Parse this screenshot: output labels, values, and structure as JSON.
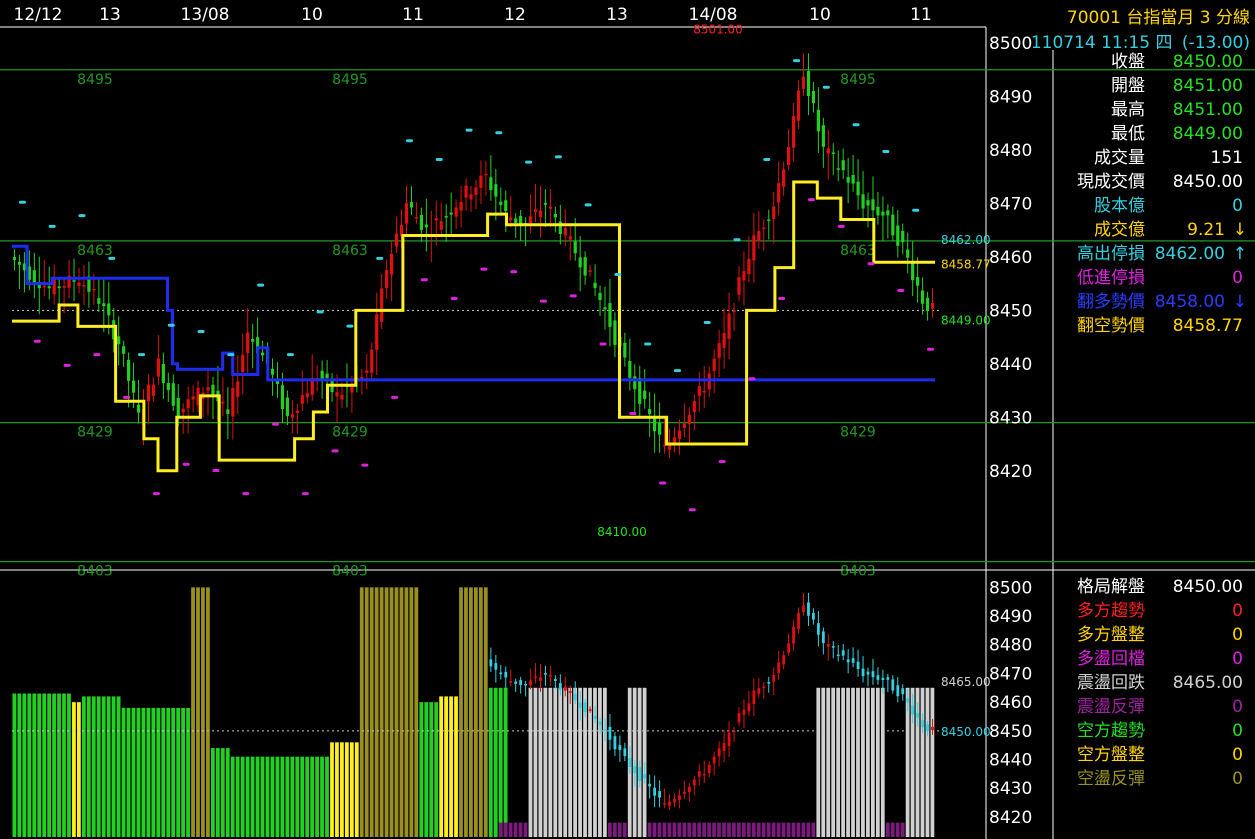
{
  "header": {
    "symbol": "70001",
    "name": "台指當月 3 分線",
    "datetime": "110714 11:15 四",
    "change": "(-13.00)"
  },
  "time_axis": [
    {
      "label": "12/12",
      "x": 38
    },
    {
      "label": "13",
      "x": 110
    },
    {
      "label": "13/08",
      "x": 205
    },
    {
      "label": "10",
      "x": 312
    },
    {
      "label": "11",
      "x": 413
    },
    {
      "label": "12",
      "x": 515
    },
    {
      "label": "13",
      "x": 617
    },
    {
      "label": "14/08",
      "x": 713
    },
    {
      "label": "10",
      "x": 820
    },
    {
      "label": "11",
      "x": 921
    }
  ],
  "quote": {
    "rows": [
      {
        "label": "收盤",
        "value": "8450.00",
        "label_color": "#ffffff",
        "value_color": "#22e022"
      },
      {
        "label": "開盤",
        "value": "8451.00",
        "label_color": "#ffffff",
        "value_color": "#22e022"
      },
      {
        "label": "最高",
        "value": "8451.00",
        "label_color": "#ffffff",
        "value_color": "#22e022"
      },
      {
        "label": "最低",
        "value": "8449.00",
        "label_color": "#ffffff",
        "value_color": "#22e022"
      },
      {
        "label": "成交量",
        "value": "151",
        "label_color": "#ffffff",
        "value_color": "#ffffff"
      },
      {
        "label": "現成交價",
        "value": "8450.00",
        "label_color": "#ffffff",
        "value_color": "#ffffff"
      },
      {
        "label": "股本億",
        "value": "0",
        "label_color": "#34d0e0",
        "value_color": "#34d0e0"
      },
      {
        "label": "成交億",
        "value": "9.21",
        "label_color": "#ffd400",
        "value_color": "#ffd400",
        "arrow": "↓",
        "arrow_color": "#ffd400"
      },
      {
        "label": "高出停損",
        "value": "8462.00",
        "label_color": "#34d0e0",
        "value_color": "#34d0e0",
        "arrow": "↑",
        "arrow_color": "#34d0e0"
      },
      {
        "label": "低進停損",
        "value": "0",
        "label_color": "#e020e0",
        "value_color": "#e020e0"
      },
      {
        "label": "翻多勢價",
        "value": "8458.00",
        "label_color": "#2a3cff",
        "value_color": "#2a3cff",
        "arrow": "↓",
        "arrow_color": "#2a3cff"
      },
      {
        "label": "翻空勢價",
        "value": "8458.77",
        "label_color": "#ffd400",
        "value_color": "#ffd400"
      }
    ]
  },
  "pattern": {
    "rows": [
      {
        "label": "格局解盤",
        "value": "8450.00",
        "label_color": "#ffffff",
        "value_color": "#ffffff"
      },
      {
        "label": "多方趨勢",
        "value": "0",
        "label_color": "#ff2020",
        "value_color": "#ff2020"
      },
      {
        "label": "多方盤整",
        "value": "0",
        "label_color": "#ffd400",
        "value_color": "#ffd400"
      },
      {
        "label": "多盪回檔",
        "value": "0",
        "label_color": "#e020e0",
        "value_color": "#e020e0"
      },
      {
        "label": "震盪回跌",
        "value": "8465.00",
        "label_color": "#d0d0d0",
        "value_color": "#d0d0d0"
      },
      {
        "label": "震盪反彈",
        "value": "0",
        "label_color": "#a020a0",
        "value_color": "#a020a0"
      },
      {
        "label": "空方趨勢",
        "value": "0",
        "label_color": "#22e022",
        "value_color": "#22e022"
      },
      {
        "label": "空方盤整",
        "value": "0",
        "label_color": "#ffd400",
        "value_color": "#ffd400"
      },
      {
        "label": "空盪反彈",
        "value": "0",
        "label_color": "#9a9020",
        "value_color": "#9a9020"
      }
    ]
  },
  "chart_data": {
    "type": "candlestick",
    "upper": {
      "yticks": [
        8500,
        8490,
        8480,
        8470,
        8460,
        8450,
        8440,
        8430,
        8420
      ],
      "ylim": [
        8402,
        8503
      ],
      "levels": [
        {
          "value": 8495,
          "label": "8495"
        },
        {
          "value": 8463,
          "label": "8463"
        },
        {
          "value": 8429,
          "label": "8429"
        },
        {
          "value": 8403,
          "label": "8403"
        }
      ],
      "annotations": [
        {
          "text": "8501.00",
          "value": 8501,
          "color": "#ff2020"
        },
        {
          "text": "8410.00",
          "value": 8410,
          "color": "#22e022"
        }
      ],
      "right_labels": [
        {
          "text": "8462.00",
          "value": 8462,
          "color": "#34d0e0"
        },
        {
          "text": "8458.77",
          "value": 8458.77,
          "color": "#ffd400"
        },
        {
          "text": "8449.00",
          "value": 8449,
          "color": "#22e022"
        }
      ],
      "current_price": 8450,
      "blue_line": [
        8462,
        8462,
        8462,
        8455,
        8455,
        8455,
        8455,
        8455,
        8456,
        8456,
        8456,
        8456,
        8456,
        8456,
        8456,
        8456,
        8456,
        8456,
        8456,
        8456,
        8456,
        8456,
        8456,
        8456,
        8456,
        8456,
        8456,
        8456,
        8456,
        8456,
        8456,
        8450,
        8440,
        8439,
        8439,
        8439,
        8439,
        8439,
        8439,
        8439,
        8439,
        8439,
        8442,
        8442,
        8438,
        8438,
        8438,
        8438,
        8438,
        8443,
        8443,
        8437,
        8437,
        8437,
        8437,
        8437,
        8437,
        8437,
        8437,
        8437,
        8437,
        8437,
        8437,
        8437,
        8437,
        8437,
        8437,
        8437,
        8437,
        8437,
        8437,
        8437,
        8437,
        8437,
        8437,
        8437,
        8437,
        8437,
        8437,
        8437,
        8437,
        8437,
        8437,
        8437,
        8437,
        8437,
        8437,
        8437,
        8437,
        8437,
        8437,
        8437,
        8437,
        8437,
        8437,
        8437,
        8437,
        8437,
        8437,
        8437,
        8437,
        8437,
        8437,
        8437,
        8437,
        8437,
        8437,
        8437,
        8437,
        8437,
        8437,
        8437,
        8437,
        8437,
        8437,
        8437,
        8437,
        8437,
        8437,
        8437,
        8437,
        8437,
        8437,
        8437,
        8437,
        8437,
        8437,
        8437,
        8437,
        8437,
        8437,
        8437,
        8437,
        8437,
        8437,
        8437,
        8437,
        8437,
        8437,
        8437,
        8437,
        8437,
        8437,
        8437,
        8437,
        8437,
        8437,
        8437,
        8437,
        8437,
        8437,
        8437,
        8437,
        8437,
        8437,
        8437,
        8437,
        8437,
        8437,
        8437,
        8437,
        8437,
        8437,
        8437,
        8437,
        8437,
        8437,
        8437,
        8437,
        8437,
        8437,
        8437,
        8437,
        8437,
        8437,
        8437,
        8437,
        8437,
        8437,
        8437,
        8437,
        8437,
        8437,
        8437
      ],
      "yellow_line": [
        8448,
        8448,
        8448,
        8448,
        8448,
        8448,
        8448,
        8448,
        8448,
        8448,
        8451,
        8451,
        8451,
        8451,
        8447,
        8447,
        8447,
        8447,
        8447,
        8447,
        8447,
        8447,
        8433,
        8433,
        8433,
        8433,
        8433,
        8433,
        8426,
        8426,
        8426,
        8420,
        8420,
        8420,
        8420,
        8430,
        8430,
        8430,
        8430,
        8430,
        8434,
        8434,
        8434,
        8434,
        8422,
        8422,
        8422,
        8422,
        8422,
        8422,
        8422,
        8422,
        8422,
        8422,
        8422,
        8422,
        8422,
        8422,
        8422,
        8422,
        8426,
        8426,
        8426,
        8426,
        8431,
        8431,
        8431,
        8436,
        8436,
        8436,
        8436,
        8436,
        8436,
        8450,
        8450,
        8450,
        8450,
        8450,
        8450,
        8450,
        8450,
        8450,
        8450,
        8464,
        8464,
        8464,
        8464,
        8464,
        8464,
        8464,
        8464,
        8464,
        8464,
        8464,
        8464,
        8464,
        8464,
        8464,
        8464,
        8464,
        8464,
        8468,
        8468,
        8468,
        8468,
        8466,
        8466,
        8466,
        8466,
        8466,
        8466,
        8466,
        8466,
        8466,
        8466,
        8466,
        8466,
        8466,
        8466,
        8466,
        8466,
        8466,
        8466,
        8466,
        8466,
        8466,
        8466,
        8466,
        8466,
        8430,
        8430,
        8430,
        8430,
        8430,
        8430,
        8430,
        8430,
        8430,
        8430,
        8425,
        8425,
        8425,
        8425,
        8425,
        8425,
        8425,
        8425,
        8425,
        8425,
        8425,
        8425,
        8425,
        8425,
        8425,
        8425,
        8425,
        8450,
        8450,
        8450,
        8450,
        8450,
        8450,
        8458,
        8458,
        8458,
        8458,
        8474,
        8474,
        8474,
        8474,
        8474,
        8471,
        8471,
        8471,
        8471,
        8471,
        8467,
        8467,
        8467,
        8467,
        8467,
        8467,
        8467,
        8459,
        8459,
        8459,
        8459,
        8459,
        8459,
        8459,
        8459,
        8459,
        8459,
        8459,
        8459,
        8459
      ]
    },
    "lower": {
      "yticks": [
        8500,
        8490,
        8480,
        8470,
        8460,
        8450,
        8440,
        8430,
        8420
      ],
      "ylim": [
        8413,
        8505
      ],
      "right_labels": [
        {
          "text": "8465.00",
          "value": 8465,
          "color": "#d0d0d0"
        },
        {
          "text": "8450.00",
          "value": 8450,
          "color": "#34d0e0"
        }
      ],
      "current_price": 8450
    }
  }
}
